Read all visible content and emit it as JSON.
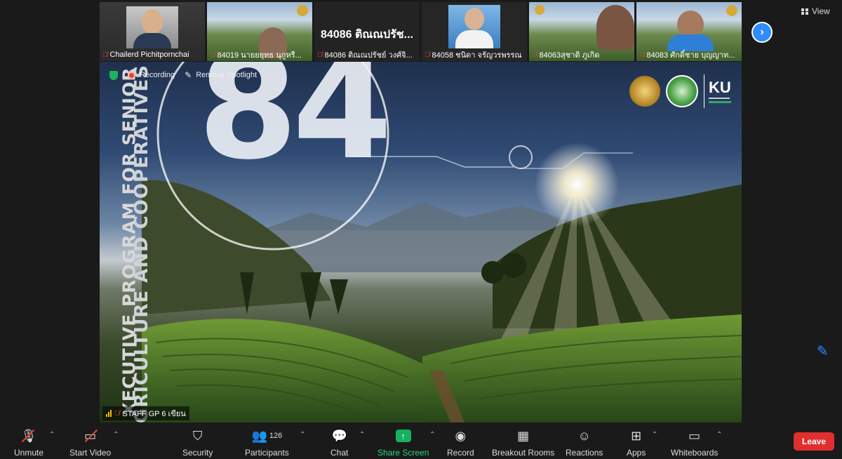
{
  "participants": [
    {
      "name": "Chailerd Pichitpornchai",
      "avatar": "person-photo",
      "mic_muted": true
    },
    {
      "name": "84019 นายยยุทธ นุกูหรื...",
      "avatar": "farm-video",
      "mic_muted": true
    },
    {
      "name": "84086 ติณณปรัชย์ วงศ์จิ...",
      "big_name": "84086 ติณณปรัช...",
      "avatar": "name-only",
      "mic_muted": true
    },
    {
      "name": "84058 ชนิดา จรัญวรพรรณ",
      "avatar": "person-photo",
      "mic_muted": true
    },
    {
      "name": "84063สุชาติ ภูเกิด",
      "avatar": "farm-video",
      "mic_muted": true
    },
    {
      "name": "84083 ศักดิ์ชาย บุญญาท...",
      "avatar": "farm-video",
      "mic_muted": true
    }
  ],
  "top_controls": {
    "view_label": "View"
  },
  "stage": {
    "recording_label": "Recording",
    "remove_spotlight_label": "Remove Spotlight",
    "big_number": "84",
    "side_line1": "XECUTIVE PROGRAM FOR SENIOR MANAGE",
    "side_line2": "GRICULTURE AND COOPERATIVES",
    "speaker_name": "STAFF GP 6 เขียน",
    "logo_text": "KU"
  },
  "toolbar": {
    "unmute": "Unmute",
    "start_video": "Start Video",
    "security": "Security",
    "participants": "Participants",
    "participants_count": "126",
    "chat": "Chat",
    "share_screen": "Share Screen",
    "record": "Record",
    "breakout_rooms": "Breakout Rooms",
    "reactions": "Reactions",
    "apps": "Apps",
    "whiteboards": "Whiteboards",
    "leave": "Leave"
  },
  "colors": {
    "accent": "#2d8cff",
    "share": "#17b060",
    "leave": "#e02f2f",
    "muted": "#e0453a"
  }
}
